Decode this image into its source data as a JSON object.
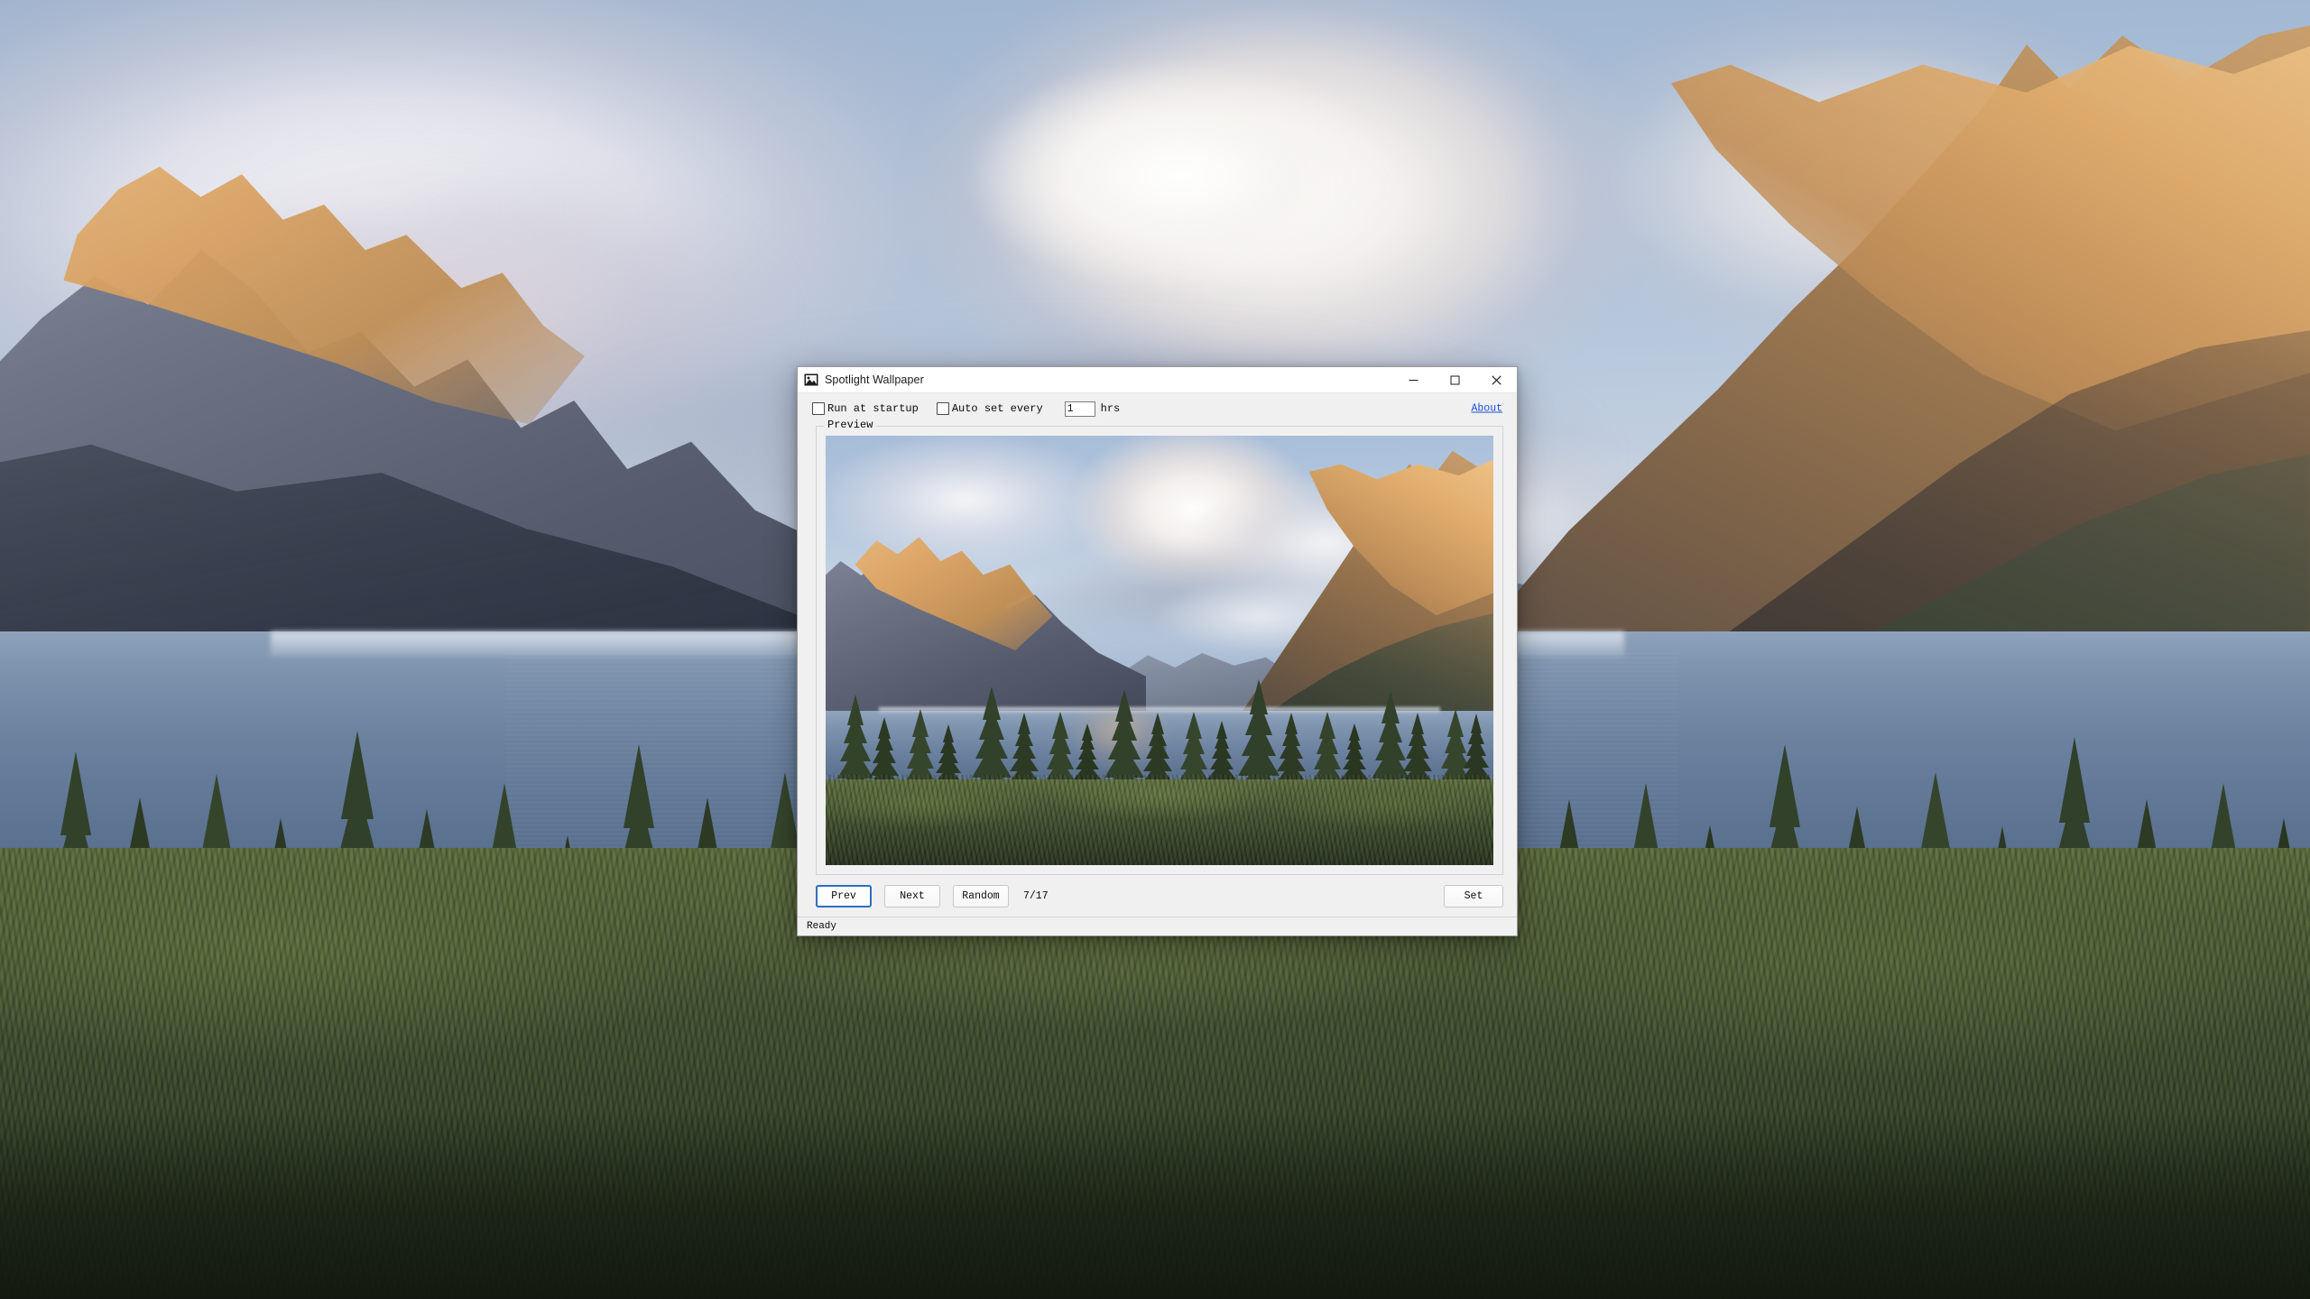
{
  "desktop": {
    "wallpaper_name": "st-mary-lake-glacier-national-park",
    "colors": {
      "sky_top": "#9fb4cf",
      "sky_mid": "#c2cfe0",
      "lake": "#6f85a2",
      "foliage": "#3f4d2f",
      "sunlit_rock": "#d9a264"
    }
  },
  "window": {
    "title": "Spotlight Wallpaper",
    "icon": "picture-icon",
    "controls": {
      "minimize": "─",
      "maximize": "☐",
      "close": "✕"
    },
    "options": {
      "run_at_startup": {
        "label": "Run at startup",
        "checked": false
      },
      "auto_set_every": {
        "label": "Auto set every",
        "checked": false,
        "value": "1",
        "unit_label": "hrs"
      },
      "about_link": "About"
    },
    "preview": {
      "legend": "Preview",
      "image_alt": "st-mary-lake-glacier-national-park"
    },
    "buttons": {
      "prev": "Prev",
      "next": "Next",
      "random": "Random",
      "set": "Set"
    },
    "counter": "7/17",
    "status": "Ready",
    "accent_color": "#2d6fc0",
    "link_color": "#1a4fd6"
  }
}
